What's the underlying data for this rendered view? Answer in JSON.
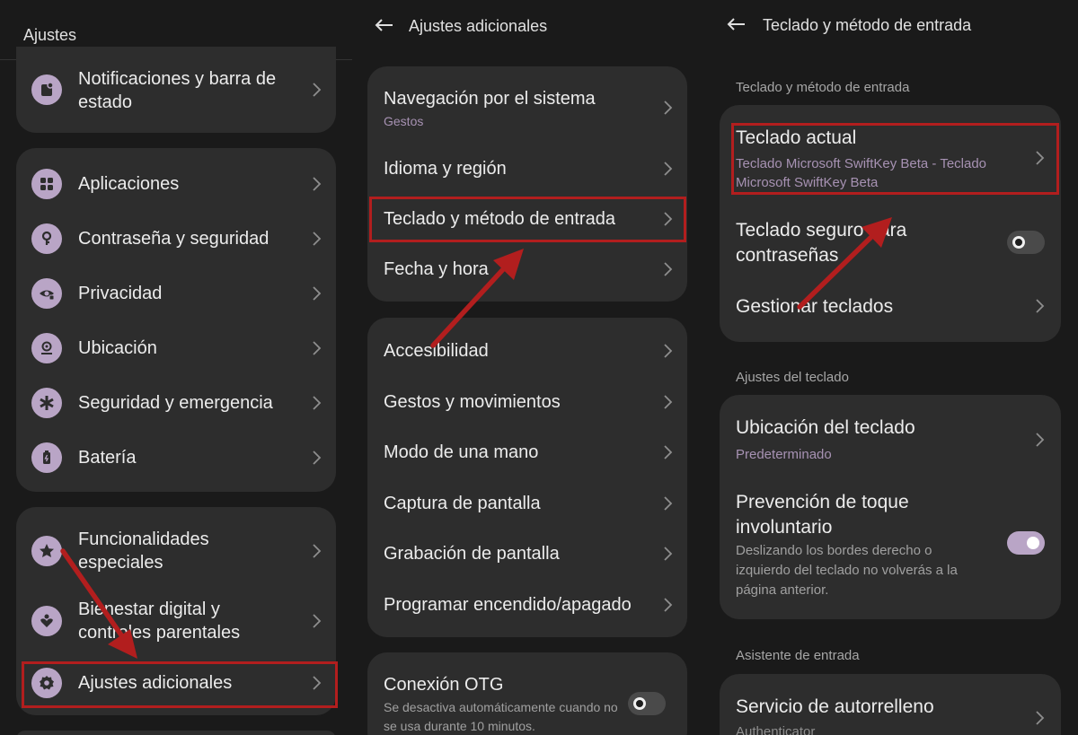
{
  "colors": {
    "background": "#1a1a1a",
    "card": "#2d2d2d",
    "accent": "#b9a5c6",
    "subtitle": "#a792b3",
    "highlight": "#b21e1e"
  },
  "panel1": {
    "title": "Ajustes",
    "items": [
      {
        "label": "Notificaciones y barra de estado",
        "icon": "notification-icon"
      },
      {
        "label": "Aplicaciones",
        "icon": "apps-icon"
      },
      {
        "label": "Contraseña y seguridad",
        "icon": "key-icon"
      },
      {
        "label": "Privacidad",
        "icon": "privacy-eye-icon"
      },
      {
        "label": "Ubicación",
        "icon": "location-icon"
      },
      {
        "label": "Seguridad y emergencia",
        "icon": "emergency-icon"
      },
      {
        "label": "Batería",
        "icon": "battery-icon"
      },
      {
        "label": "Funcionalidades especiales",
        "icon": "star-icon"
      },
      {
        "label": "Bienestar digital y controles parentales",
        "icon": "wellbeing-icon"
      },
      {
        "label": "Ajustes adicionales",
        "icon": "gear-icon"
      }
    ]
  },
  "panel2": {
    "title": "Ajustes adicionales",
    "items": [
      {
        "label": "Navegación por el sistema",
        "subtitle": "Gestos"
      },
      {
        "label": "Idioma y región"
      },
      {
        "label": "Teclado y método de entrada"
      },
      {
        "label": "Fecha y hora"
      },
      {
        "label": "Accesibilidad"
      },
      {
        "label": "Gestos y movimientos"
      },
      {
        "label": "Modo de una mano"
      },
      {
        "label": "Captura de pantalla"
      },
      {
        "label": "Grabación de pantalla"
      },
      {
        "label": "Programar encendido/apagado"
      },
      {
        "label": "Conexión OTG",
        "description": "Se desactiva automáticamente cuando no se usa durante 10 minutos.",
        "toggle": false
      }
    ]
  },
  "panel3": {
    "title": "Teclado y método de entrada",
    "sections": [
      {
        "header": "Teclado y método de entrada"
      },
      {
        "header": "Ajustes del teclado"
      },
      {
        "header": "Asistente de entrada"
      }
    ],
    "items": [
      {
        "label": "Teclado actual",
        "subtitle": "Teclado Microsoft SwiftKey Beta - Teclado Microsoft SwiftKey Beta"
      },
      {
        "label": "Teclado seguro para contraseñas",
        "toggle": false
      },
      {
        "label": "Gestionar teclados"
      },
      {
        "label": "Ubicación del teclado",
        "subtitle": "Predeterminado"
      },
      {
        "label": "Prevención de toque involuntario",
        "description": "Deslizando los bordes derecho o izquierdo del teclado no volverás a la página anterior.",
        "toggle": true
      },
      {
        "label": "Servicio de autorrelleno",
        "subtitle": "Authenticator"
      }
    ]
  }
}
